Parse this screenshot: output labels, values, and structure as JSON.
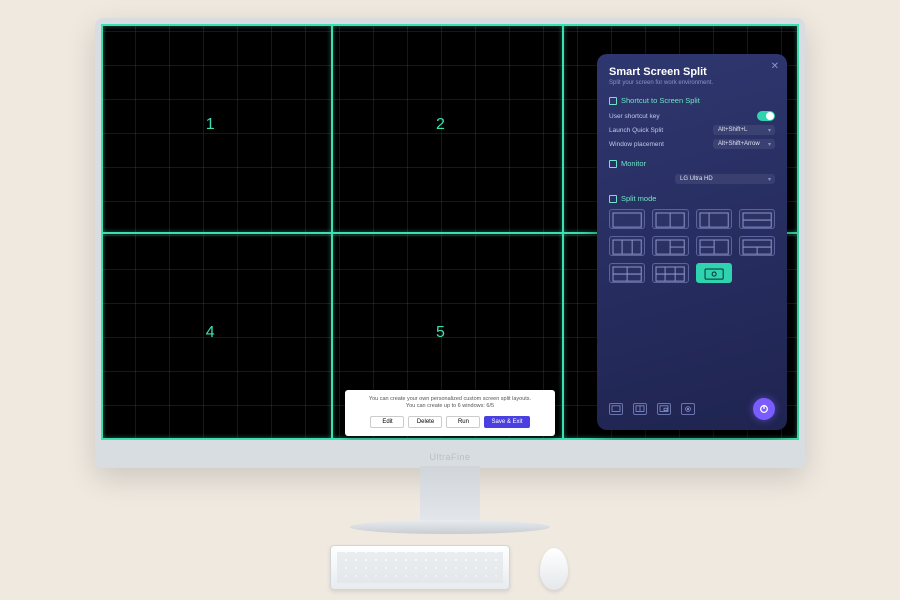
{
  "brand": "UltraFine",
  "zones": {
    "z1": "1",
    "z2": "2",
    "z4": "4",
    "z5": "5"
  },
  "bottom": {
    "line1": "You can create your own personalized custom screen split layouts.",
    "line2": "You can create up to 6 windows: 6/5",
    "btn_edit": "Edit",
    "btn_delete": "Delete",
    "btn_run": "Run",
    "btn_save": "Save & Exit"
  },
  "panel": {
    "title": "Smart Screen Split",
    "subtitle": "Split your screen for work environment.",
    "sect_shortcut": "Shortcut to Screen Split",
    "row_userkey": "User shortcut key",
    "row_launch": "Launch Quick Split",
    "val_launch": "Alt+Shift+L",
    "row_window": "Window placement",
    "val_window": "Alt+Shift+Arrow",
    "sect_monitor": "Monitor",
    "val_monitor": "LG Ultra HD",
    "sect_splitmode": "Split mode"
  }
}
